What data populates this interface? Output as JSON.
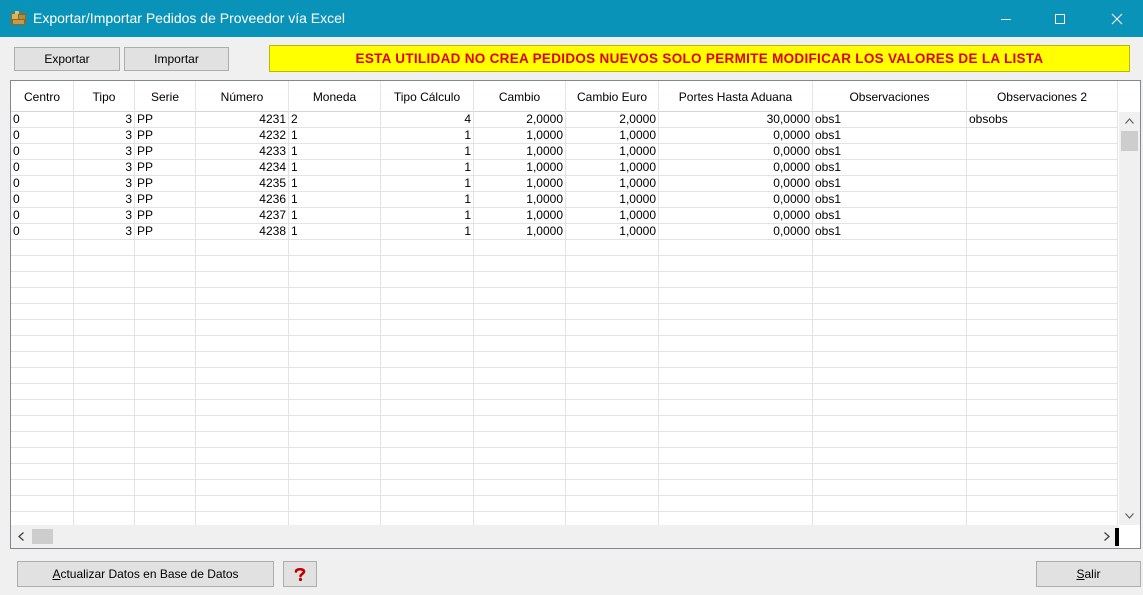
{
  "window": {
    "title": "Exportar/Importar Pedidos de Proveedor vía Excel",
    "titlebar_color": "#0a93b8"
  },
  "toolbar": {
    "exportar_label": "Exportar",
    "importar_label": "Importar",
    "warning_text": "ESTA UTILIDAD NO CREA PEDIDOS NUEVOS SOLO PERMITE MODIFICAR LOS VALORES DE LA LISTA",
    "warning_bg": "#ffff00",
    "warning_color": "#e00000"
  },
  "grid": {
    "columns": [
      "Centro",
      "Tipo",
      "Serie",
      "Número",
      "Moneda",
      "Tipo Cálculo",
      "Cambio",
      "Cambio Euro",
      "Portes Hasta Aduana",
      "Observaciones",
      "Observaciones 2"
    ],
    "rows": [
      [
        "0",
        "3",
        "PP",
        "4231",
        "2",
        "4",
        "2,0000",
        "2,0000",
        "30,0000",
        "obs1",
        "obsobs"
      ],
      [
        "0",
        "3",
        "PP",
        "4232",
        "1",
        "1",
        "1,0000",
        "1,0000",
        "0,0000",
        "obs1",
        ""
      ],
      [
        "0",
        "3",
        "PP",
        "4233",
        "1",
        "1",
        "1,0000",
        "1,0000",
        "0,0000",
        "obs1",
        ""
      ],
      [
        "0",
        "3",
        "PP",
        "4234",
        "1",
        "1",
        "1,0000",
        "1,0000",
        "0,0000",
        "obs1",
        ""
      ],
      [
        "0",
        "3",
        "PP",
        "4235",
        "1",
        "1",
        "1,0000",
        "1,0000",
        "0,0000",
        "obs1",
        ""
      ],
      [
        "0",
        "3",
        "PP",
        "4236",
        "1",
        "1",
        "1,0000",
        "1,0000",
        "0,0000",
        "obs1",
        ""
      ],
      [
        "0",
        "3",
        "PP",
        "4237",
        "1",
        "1",
        "1,0000",
        "1,0000",
        "0,0000",
        "obs1",
        ""
      ],
      [
        "0",
        "3",
        "PP",
        "4238",
        "1",
        "1",
        "1,0000",
        "1,0000",
        "0,0000",
        "obs1",
        ""
      ]
    ]
  },
  "bottom": {
    "actualizar_prefix": "A",
    "actualizar_rest": "ctualizar Datos en Base de Datos",
    "help_icon": "help-icon",
    "salir_prefix": "S",
    "salir_rest": "alir"
  }
}
